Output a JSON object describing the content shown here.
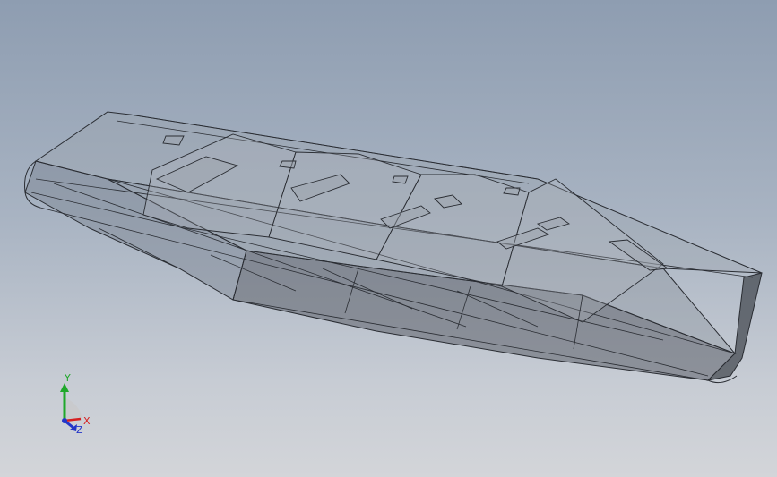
{
  "viewport": {
    "background_top": "#8e9db1",
    "background_bottom": "#d3d5d9",
    "model_display": "wireframe-transparent"
  },
  "triad": {
    "x_label": "X",
    "y_label": "Y",
    "z_label": "Z",
    "x_color": "#d62020",
    "y_color": "#1fa82a",
    "z_color": "#2335c8"
  },
  "model": {
    "edge_color": "#2a2d33",
    "body_fill": "#7d8590",
    "shadow_fill": "#4a4f57"
  }
}
